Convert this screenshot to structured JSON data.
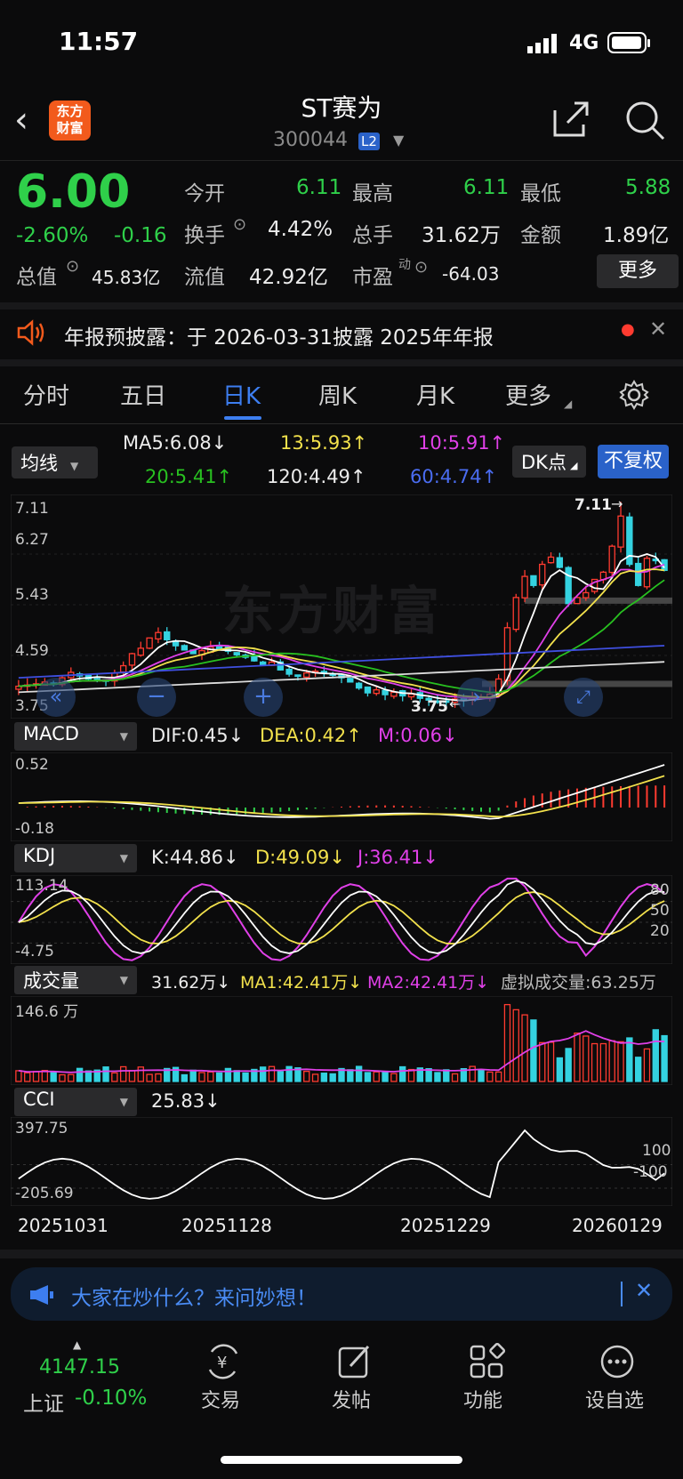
{
  "status": {
    "time": "11:57",
    "network": "4G"
  },
  "header": {
    "title": "ST赛为",
    "code": "300044",
    "level_badge": "L2",
    "logo_line1": "东方",
    "logo_line2": "财富"
  },
  "quote": {
    "price": "6.00",
    "change_pct": "-2.60%",
    "change": "-0.16",
    "open_label": "今开",
    "open": "6.11",
    "high_label": "最高",
    "high": "6.11",
    "low_label": "最低",
    "low": "5.88",
    "turnover_label": "换手",
    "turnover": "4.42%",
    "volume_label": "总手",
    "volume": "31.62万",
    "amount_label": "金额",
    "amount": "1.89亿",
    "mktcap_label": "总值",
    "mktcap": "45.83亿",
    "float_label": "流值",
    "float": "42.92亿",
    "pe_label": "市盈",
    "pe_sup": "动",
    "pe": "-64.03",
    "more_label": "更多"
  },
  "notice": {
    "text": "年报预披露：于 2026-03-31披露 2025年年报"
  },
  "tabs": [
    "分时",
    "五日",
    "日K",
    "周K",
    "月K",
    "更多"
  ],
  "ma": {
    "selector": "均线",
    "ma5": "MA5:6.08↓",
    "ma13": "13:5.93↑",
    "ma10": "10:5.91↑",
    "ma20": "20:5.41↑",
    "ma120": "120:4.49↑",
    "ma60": "60:4.74↑",
    "dk_label": "DK点",
    "fq_label": "不复权"
  },
  "price_axis": {
    "high": "7.11",
    "l2": "6.27",
    "l3": "5.43",
    "l4": "4.59",
    "low": "3.75",
    "high_mark": "7.11",
    "low_mark": "3.75",
    "watermark": "东方财富"
  },
  "macd": {
    "label": "MACD",
    "dif": "DIF:0.45↓",
    "dea": "DEA:0.42↑",
    "m": "M:0.06↓",
    "top": "0.52",
    "bottom": "-0.18"
  },
  "kdj": {
    "label": "KDJ",
    "k": "K:44.86↓",
    "d": "D:49.09↓",
    "j": "J:36.41↓",
    "top": "113.14",
    "bottom": "-4.75",
    "r80": "80",
    "r50": "50",
    "r20": "20"
  },
  "vol": {
    "label": "成交量",
    "v": "31.62万↓",
    "ma1": "MA1:42.41万↓",
    "ma2": "MA2:42.41万↓",
    "virtual": "虚拟成交量:63.25万",
    "top": "146.6 万"
  },
  "cci": {
    "label": "CCI",
    "v": "25.83↓",
    "top": "397.75",
    "bottom": "-205.69",
    "r100": "100",
    "rn100": "-100"
  },
  "dates": [
    "20251031",
    "20251128",
    "20251229",
    "20260129"
  ],
  "banner": {
    "text": "大家在炒什么？来问妙想！"
  },
  "nav": {
    "index_value": "4147.15",
    "index_name": "上证",
    "index_change": "-0.10%",
    "trade": "交易",
    "post": "发帖",
    "func": "功能",
    "watch": "设自选"
  },
  "colors": {
    "up": "#ff3b30",
    "down": "#2fd04a",
    "accent": "#3d7ef0",
    "ma5": "#ffffff",
    "ma10": "#e040e8",
    "ma20": "#28c020",
    "ma60": "#3f4fe0"
  },
  "chart_data": {
    "type": "candlestick",
    "price_range": [
      3.75,
      7.11
    ],
    "close": [
      4.08,
      4.1,
      4.12,
      4.15,
      4.11,
      4.22,
      4.31,
      4.25,
      4.2,
      4.19,
      4.18,
      4.3,
      4.42,
      4.62,
      4.71,
      4.88,
      4.97,
      4.85,
      4.75,
      4.68,
      4.62,
      4.67,
      4.73,
      4.7,
      4.66,
      4.6,
      4.56,
      4.5,
      4.43,
      4.48,
      4.35,
      4.28,
      4.25,
      4.3,
      4.33,
      4.3,
      4.26,
      4.22,
      4.15,
      4.05,
      3.97,
      4.02,
      3.94,
      3.98,
      3.92,
      3.95,
      3.88,
      3.85,
      3.83,
      3.82,
      3.87,
      3.84,
      3.91,
      3.9,
      3.95,
      4.2,
      5.05,
      5.55,
      5.9,
      5.75,
      6.1,
      6.22,
      6.05,
      5.45,
      5.55,
      5.63,
      5.85,
      5.97,
      6.4,
      6.9,
      6.1,
      5.75,
      6.2,
      6.16,
      6.0
    ],
    "ma5_last": 6.08,
    "ma10_last": 5.91,
    "ma13_last": 5.93,
    "ma20_last": 5.41,
    "ma60_last": 4.74,
    "ma120_last": 4.49
  }
}
